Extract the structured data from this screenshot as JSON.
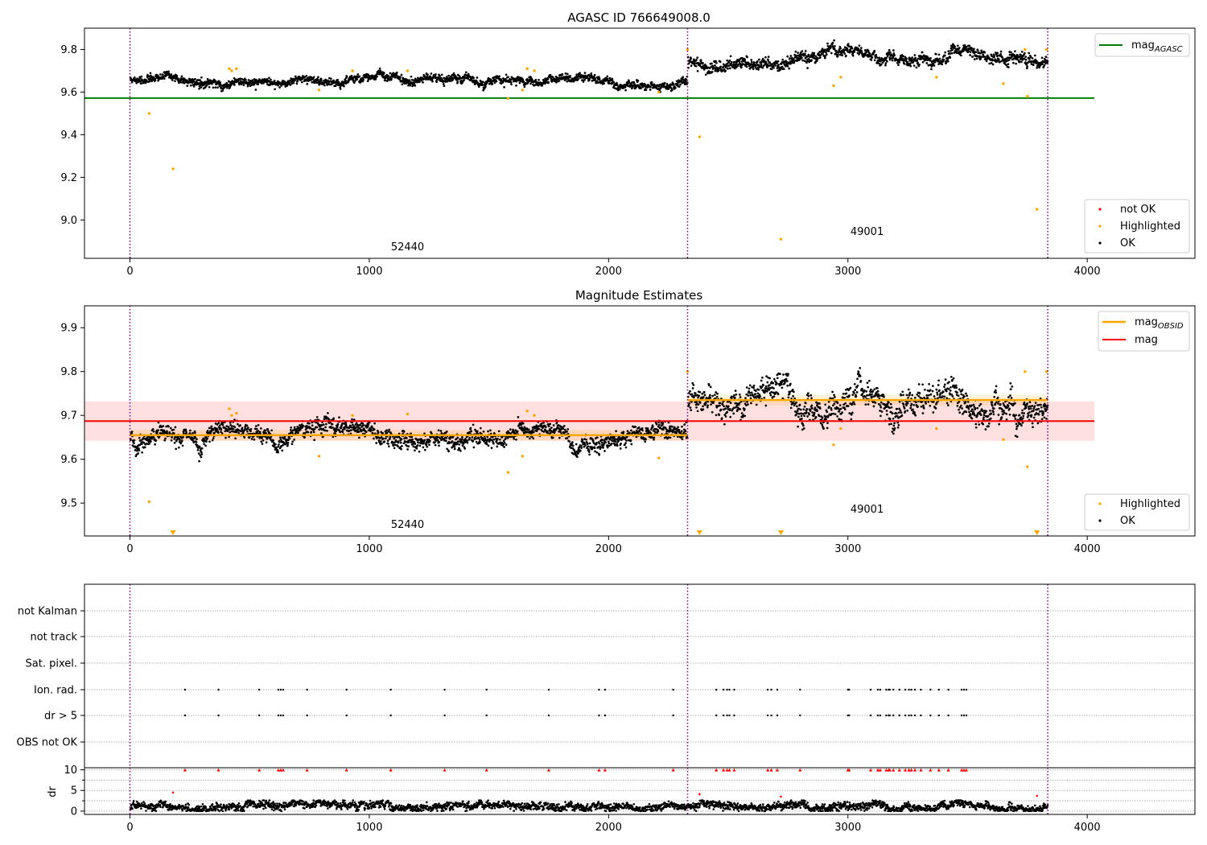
{
  "figure": {
    "x_ticks": [
      "0",
      "1000",
      "2000",
      "3000",
      "4000"
    ],
    "obsid_boundaries": [
      0,
      2330,
      3835
    ],
    "obsid_labels": [
      {
        "text": "52440",
        "x": 1160
      },
      {
        "text": "49001",
        "x": 3080
      }
    ]
  },
  "chart_data": [
    {
      "type": "scatter",
      "title": "AGASC ID 766649008.0",
      "xlim": [
        -190,
        4450
      ],
      "ylim": [
        8.82,
        9.9
      ],
      "y_ticks": [
        "9.8",
        "9.6",
        "9.4",
        "9.2",
        "9.0"
      ],
      "x_ticks": [
        "0",
        "1000",
        "2000",
        "3000",
        "4000"
      ],
      "series": [
        {
          "name": "OK",
          "color": "#000000",
          "segments": [
            {
              "x_range": [
                0,
                2330
              ],
              "mean": 9.655,
              "sd": 0.012
            },
            {
              "x_range": [
                2330,
                3835
              ],
              "mean": 9.74,
              "sd": 0.018
            }
          ]
        },
        {
          "name": "Highlighted",
          "color": "#ffa500",
          "points": [
            [
              80,
              9.5
            ],
            [
              180,
              9.24
            ],
            [
              415,
              9.71
            ],
            [
              425,
              9.7
            ],
            [
              445,
              9.71
            ],
            [
              790,
              9.61
            ],
            [
              930,
              9.7
            ],
            [
              1160,
              9.7
            ],
            [
              1580,
              9.57
            ],
            [
              1640,
              9.61
            ],
            [
              1660,
              9.71
            ],
            [
              1690,
              9.7
            ],
            [
              2210,
              9.6
            ],
            [
              2330,
              9.8
            ],
            [
              2380,
              9.39
            ],
            [
              2720,
              8.91
            ],
            [
              2940,
              9.63
            ],
            [
              2970,
              9.67
            ],
            [
              3370,
              9.67
            ],
            [
              3650,
              9.64
            ],
            [
              3740,
              9.8
            ],
            [
              3750,
              9.58
            ],
            [
              3790,
              9.05
            ],
            [
              3830,
              9.8
            ]
          ]
        },
        {
          "name": "not OK",
          "color": "#ff0000",
          "points": []
        }
      ],
      "mag_agasc": {
        "value": 9.572,
        "x_range": [
          -190,
          4030
        ],
        "color": "#008000"
      },
      "legend_top": [
        "mag$_{AGASC}$"
      ],
      "legend_bottom": [
        "not OK",
        "Highlighted",
        "OK"
      ]
    },
    {
      "type": "scatter",
      "title": "Magnitude Estimates",
      "xlim": [
        -190,
        4450
      ],
      "ylim": [
        9.425,
        9.95
      ],
      "y_ticks": [
        "9.9",
        "9.8",
        "9.7",
        "9.6",
        "9.5"
      ],
      "x_ticks": [
        "0",
        "1000",
        "2000",
        "3000",
        "4000"
      ],
      "series": [
        {
          "name": "OK",
          "color": "#000000",
          "segments": [
            {
              "x_range": [
                0,
                2330
              ],
              "mean": 9.655,
              "sd": 0.012
            },
            {
              "x_range": [
                2330,
                3835
              ],
              "mean": 9.735,
              "sd": 0.02
            }
          ]
        },
        {
          "name": "Highlighted",
          "color": "#ffa500",
          "points": [
            [
              80,
              9.503
            ],
            [
              415,
              9.715
            ],
            [
              425,
              9.7
            ],
            [
              445,
              9.705
            ],
            [
              790,
              9.607
            ],
            [
              930,
              9.7
            ],
            [
              1160,
              9.703
            ],
            [
              1580,
              9.57
            ],
            [
              1640,
              9.607
            ],
            [
              1660,
              9.71
            ],
            [
              1690,
              9.7
            ],
            [
              2210,
              9.603
            ],
            [
              2330,
              9.8
            ],
            [
              2940,
              9.633
            ],
            [
              2970,
              9.67
            ],
            [
              3370,
              9.67
            ],
            [
              3650,
              9.645
            ],
            [
              3740,
              9.8
            ],
            [
              3750,
              9.583
            ],
            [
              3830,
              9.8
            ]
          ]
        }
      ],
      "below_limit_markers": [
        180,
        2380,
        2720,
        3790
      ],
      "mag_obsid": [
        {
          "x_range": [
            0,
            2330
          ],
          "value": 9.655
        },
        {
          "x_range": [
            2330,
            3835
          ],
          "value": 9.735
        }
      ],
      "mag": {
        "value": 9.687,
        "band": [
          9.642,
          9.732
        ],
        "x_range": [
          -190,
          4030
        ]
      },
      "legend_top": [
        "mag$_{OBSID}$",
        "mag"
      ],
      "legend_bottom": [
        "Highlighted",
        "OK"
      ]
    },
    {
      "type": "scatter",
      "title": "",
      "xlim": [
        -190,
        4450
      ],
      "categories": [
        "not Kalman",
        "not track",
        "Sat. pixel.",
        "Ion. rad.",
        "dr > 5",
        "OBS not OK"
      ],
      "flag_points": {
        "Ion. rad.": [
          230,
          370,
          540,
          620,
          630,
          640,
          740,
          905,
          1090,
          1315,
          1490,
          1750,
          1960,
          1985,
          2270,
          2450,
          2480,
          2495,
          2505,
          2525,
          2665,
          2680,
          2705,
          2800,
          3000,
          3005,
          3095,
          3125,
          3135,
          3160,
          3170,
          3175,
          3190,
          3215,
          3240,
          3255,
          3265,
          3280,
          3305,
          3345,
          3380,
          3420,
          3475,
          3485,
          3495
        ],
        "dr > 5": [
          230,
          370,
          540,
          620,
          630,
          640,
          740,
          905,
          1090,
          1315,
          1490,
          1750,
          1960,
          1985,
          2270,
          2450,
          2480,
          2495,
          2505,
          2525,
          2665,
          2680,
          2705,
          2800,
          3000,
          3005,
          3095,
          3125,
          3135,
          3160,
          3170,
          3175,
          3190,
          3215,
          3240,
          3255,
          3265,
          3280,
          3305,
          3345,
          3380,
          3420,
          3475,
          3485,
          3495
        ]
      }
    },
    {
      "type": "scatter",
      "title": "",
      "xlim": [
        -190,
        4450
      ],
      "ylim": [
        -0.8,
        10.5
      ],
      "ylabel": "dr",
      "y_ticks": [
        "10",
        "5",
        "0"
      ],
      "x_ticks": [
        "0",
        "1000",
        "2000",
        "3000",
        "4000"
      ],
      "clipped_points_at_10": [
        230,
        370,
        540,
        620,
        630,
        640,
        740,
        905,
        1090,
        1315,
        1490,
        1750,
        1960,
        1985,
        2270,
        2450,
        2480,
        2495,
        2505,
        2525,
        2665,
        2680,
        2705,
        2800,
        3000,
        3005,
        3095,
        3125,
        3135,
        3160,
        3170,
        3175,
        3190,
        3215,
        3240,
        3255,
        3265,
        3280,
        3305,
        3345,
        3380,
        3420,
        3475,
        3485,
        3495
      ],
      "red_points": [
        [
          180,
          4.5
        ],
        [
          2380,
          4.1
        ],
        [
          2720,
          3.5
        ],
        [
          3790,
          3.7
        ]
      ],
      "ok_baseline": {
        "x_range": [
          0,
          3835
        ],
        "mean": 1.0,
        "sd": 0.45
      }
    }
  ]
}
